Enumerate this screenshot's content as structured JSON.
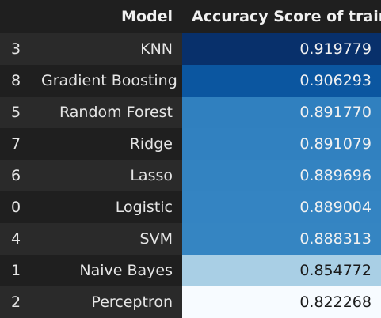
{
  "header": {
    "index_label": "",
    "model_label": "Model",
    "score_label": "Accuracy Score of train"
  },
  "rows": [
    {
      "index": "3",
      "model": "KNN",
      "score": "0.919779",
      "bg": "#08306b",
      "fg": "#f1f1f1"
    },
    {
      "index": "8",
      "model": "Gradient Boosting",
      "score": "0.906293",
      "bg": "#0b56a0",
      "fg": "#f1f1f1"
    },
    {
      "index": "5",
      "model": "Random Forest",
      "score": "0.891770",
      "bg": "#3080bf",
      "fg": "#f1f1f1"
    },
    {
      "index": "7",
      "model": "Ridge",
      "score": "0.891079",
      "bg": "#3181c0",
      "fg": "#f1f1f1"
    },
    {
      "index": "6",
      "model": "Lasso",
      "score": "0.889696",
      "bg": "#3383c1",
      "fg": "#f1f1f1"
    },
    {
      "index": "0",
      "model": "Logistic",
      "score": "0.889004",
      "bg": "#3484c2",
      "fg": "#f1f1f1"
    },
    {
      "index": "4",
      "model": "SVM",
      "score": "0.888313",
      "bg": "#3585c2",
      "fg": "#f1f1f1"
    },
    {
      "index": "1",
      "model": "Naive Bayes",
      "score": "0.854772",
      "bg": "#a9cfe5",
      "fg": "#1a1a1a"
    },
    {
      "index": "2",
      "model": "Perceptron",
      "score": "0.822268",
      "bg": "#f7fbff",
      "fg": "#1a1a1a"
    }
  ]
}
